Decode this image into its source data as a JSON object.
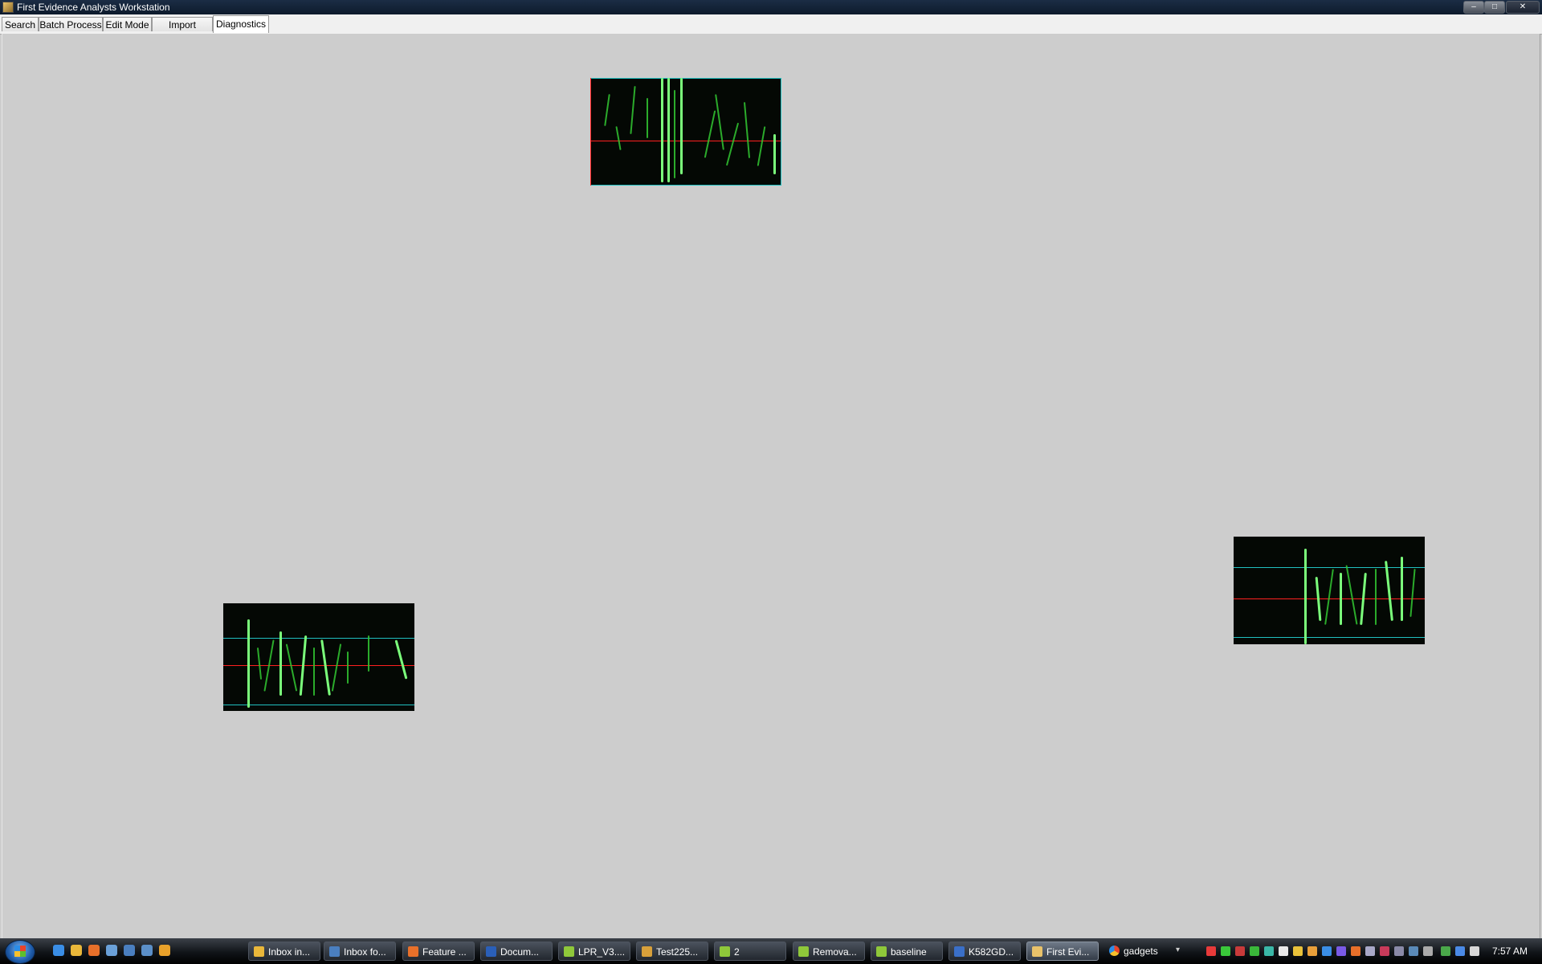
{
  "window": {
    "title": "First Evidence Analysts Workstation",
    "controls": [
      "minimize",
      "maximize",
      "close"
    ]
  },
  "tabs": [
    {
      "label": "Search",
      "active": false
    },
    {
      "label": "Batch Process",
      "active": false
    },
    {
      "label": "Edit Mode",
      "active": false
    },
    {
      "label": "Import Images",
      "active": false
    },
    {
      "label": "Diagnostics",
      "active": true
    }
  ],
  "diagnostics": {
    "panel_background": "#cdcdcd",
    "plates": [
      {
        "name": "plate-top"
      },
      {
        "name": "plate-bottom-left"
      },
      {
        "name": "plate-bottom-right"
      }
    ],
    "colors": {
      "plate_bg": "#040804",
      "stroke": "#32c832",
      "center_line": "#ff2020",
      "guide_line": "#20c0c0"
    }
  },
  "taskbar": {
    "start_icon": "windows-orb-icon",
    "quick_launch": [
      "internet-explorer-icon",
      "messenger-icon",
      "firefox-icon",
      "tools-icon",
      "desktop-icon",
      "window-switch-icon",
      "media-player-icon"
    ],
    "tasks": [
      {
        "label": "Inbox in..."
      },
      {
        "label": "Inbox fo..."
      },
      {
        "label": "Feature ..."
      },
      {
        "label": "Docum..."
      },
      {
        "label": "LPR_V3...."
      },
      {
        "label": "Test225..."
      },
      {
        "label": "2"
      },
      {
        "label": "Remova..."
      },
      {
        "label": "baseline"
      },
      {
        "label": "K582GD..."
      },
      {
        "label": "First Evi..."
      },
      {
        "label": "gadgets"
      }
    ],
    "active_task": "First Evi...",
    "clock": "7:57 AM"
  }
}
